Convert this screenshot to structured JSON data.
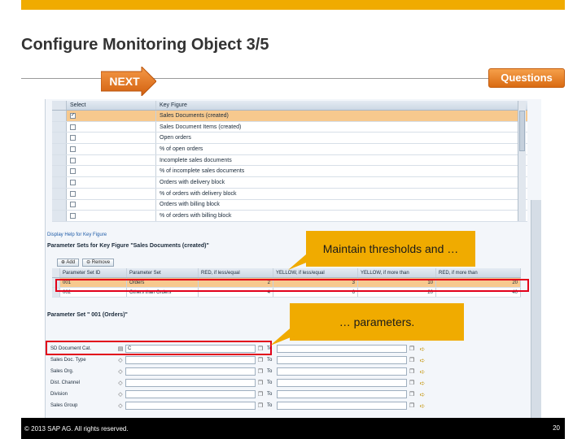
{
  "slide": {
    "title": "Configure Monitoring Object 3/5",
    "next_label": "NEXT",
    "questions_label": "Questions",
    "copyright": "© 2013 SAP AG. All rights reserved.",
    "page_number": "20",
    "accent": "#f0ab00"
  },
  "kf_table": {
    "col_select": "Select",
    "col_key_figure": "Key Figure",
    "rows": [
      {
        "checked": "✓",
        "label": "Sales Documents (created)"
      },
      {
        "checked": "",
        "label": "Sales Document Items (created)"
      },
      {
        "checked": "",
        "label": "Open orders"
      },
      {
        "checked": "",
        "label": "% of open orders"
      },
      {
        "checked": "",
        "label": "Incomplete sales documents"
      },
      {
        "checked": "",
        "label": "% of incomplete sales documents"
      },
      {
        "checked": "",
        "label": "Orders with delivery block"
      },
      {
        "checked": "",
        "label": "% of orders with delivery block"
      },
      {
        "checked": "",
        "label": "Orders with billing block"
      },
      {
        "checked": "",
        "label": "% of orders with billing block"
      }
    ]
  },
  "help_link": "Display Help for Key Figure",
  "param_sets": {
    "title": "Parameter Sets for Key Figure \"Sales Documents (created)\"",
    "add_label": "Add",
    "remove_label": "Remove",
    "headers": [
      "Parameter Set ID",
      "Parameter Set",
      "RED, if less/equal",
      "YELLOW, if less/equal",
      "YELLOW, if more than",
      "RED, if more than"
    ],
    "rows": [
      {
        "id": "001",
        "name": "Orders",
        "red_le": "2",
        "yellow_le": "3",
        "yellow_gt": "10",
        "red_gt": "20"
      },
      {
        "id": "002",
        "name": "Others than Orders",
        "red_le": "4",
        "yellow_le": "6",
        "yellow_gt": "20",
        "red_gt": "40"
      }
    ]
  },
  "param_set_detail": {
    "title": "Parameter Set \" 001 (Orders)\"",
    "to_label": "To",
    "rows": [
      {
        "label": "SD Document Cat.",
        "from": "C"
      },
      {
        "label": "Sales Doc. Type",
        "from": ""
      },
      {
        "label": "Sales Org.",
        "from": ""
      },
      {
        "label": "Dist. Channel",
        "from": ""
      },
      {
        "label": "Division",
        "from": ""
      },
      {
        "label": "Sales Group",
        "from": ""
      }
    ]
  },
  "callouts": {
    "thresholds": "Maintain thresholds and …",
    "parameters": "… parameters."
  }
}
